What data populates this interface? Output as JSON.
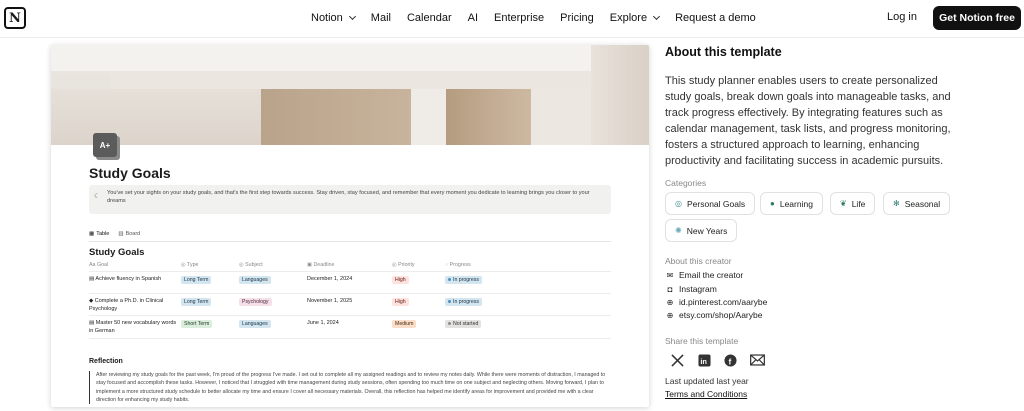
{
  "nav": {
    "logo": "N",
    "items": [
      {
        "label": "Notion",
        "has_chevron": true
      },
      {
        "label": "Mail",
        "has_chevron": false
      },
      {
        "label": "Calendar",
        "has_chevron": false
      },
      {
        "label": "AI",
        "has_chevron": false
      },
      {
        "label": "Enterprise",
        "has_chevron": false
      },
      {
        "label": "Pricing",
        "has_chevron": false
      },
      {
        "label": "Explore",
        "has_chevron": true
      },
      {
        "label": "Request a demo",
        "has_chevron": false
      }
    ],
    "login": "Log in",
    "cta": "Get Notion free"
  },
  "preview": {
    "page_icon": "A+",
    "title": "Study Goals",
    "callout": "You've set your sights on your study goals, and that's the first step towards success. Stay driven, stay focused, and remember that every moment you dedicate to learning brings you closer to your dreams",
    "views": [
      "Table",
      "Board"
    ],
    "db_title": "Study Goals",
    "columns": [
      "Goal",
      "Type",
      "Subject",
      "Deadline",
      "Priority",
      "Progress"
    ],
    "rows": [
      {
        "goal": "Achieve fluency in Spanish",
        "type": "Long Term",
        "subject": "Languages",
        "deadline": "December 1, 2024",
        "priority": "High",
        "progress": "In progress"
      },
      {
        "goal": "Complete a Ph.D. in Clinical Psychology",
        "type": "Long Term",
        "subject": "Psychology",
        "deadline": "November 1, 2025",
        "priority": "High",
        "progress": "In progress"
      },
      {
        "goal": "Master 50 new vocabulary words in German",
        "type": "Short Term",
        "subject": "Languages",
        "deadline": "June 1, 2024",
        "priority": "Medium",
        "progress": "Not started"
      }
    ],
    "reflection_title": "Reflection",
    "reflection_text": "After reviewing my study goals for the past week, I'm proud of the progress I've made. I set out to complete all my assigned readings and to review my notes daily. While there were moments of distraction, I managed to stay focused and accomplish these tasks. However, I noticed that I struggled with time management during study sessions, often spending too much time on one subject and neglecting others. Moving forward, I plan to implement a more structured study schedule to better allocate my time and ensure I cover all necessary materials. Overall, this reflection has helped me identify areas for improvement and provided me with a clear direction for enhancing my study habits."
  },
  "about": {
    "title": "About this template",
    "body": "This study planner enables users to create personalized study goals, break down goals into manageable tasks, and track progress effectively. By integrating features such as calendar management, task lists, and progress monitoring, fosters a structured approach to learning, enhancing productivity and facilitating success in academic pursuits.",
    "categories_label": "Categories",
    "categories": [
      "Personal Goals",
      "Learning",
      "Life",
      "Seasonal",
      "New Years"
    ],
    "creator_label": "About this creator",
    "creator_links": [
      "Email the creator",
      "Instagram",
      "id.pinterest.com/aarybe",
      "etsy.com/shop/Aarybe"
    ],
    "share_label": "Share this template",
    "updated": "Last updated last year",
    "terms": "Terms and Conditions"
  }
}
